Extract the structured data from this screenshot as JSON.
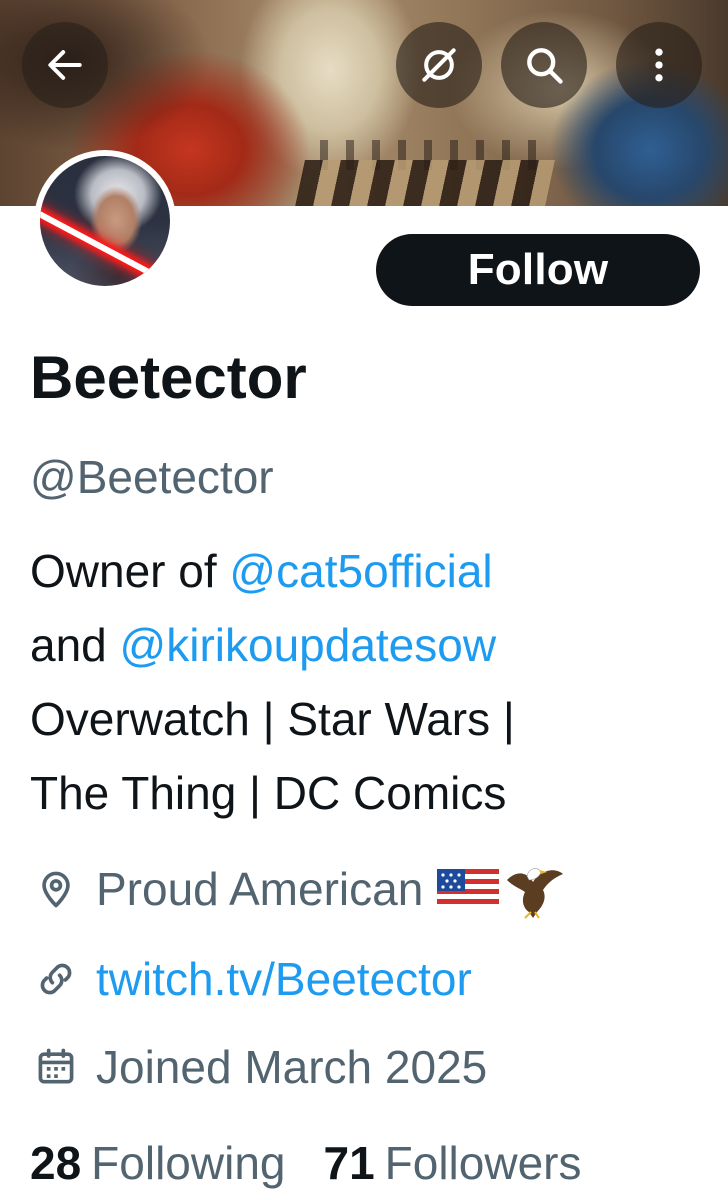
{
  "profile": {
    "display_name": "Beetector",
    "handle": "@Beetector",
    "follow_label": "Follow",
    "bio": {
      "line1_prefix": "Owner of ",
      "line1_mention": "@cat5official",
      "line2_prefix": "and ",
      "line2_mention": "@kirikoupdatesow",
      "line3": "Overwatch | Star Wars |",
      "line4": "The Thing | DC Comics"
    },
    "location": "Proud American",
    "location_icons": [
      "us-flag-icon",
      "eagle-icon"
    ],
    "website": "twitch.tv/Beetector",
    "joined": "Joined March 2025",
    "following_count": "28",
    "following_label": "Following",
    "followers_count": "71",
    "followers_label": "Followers"
  },
  "header_icons": [
    "back-arrow-icon",
    "notifications-off-icon",
    "search-icon",
    "more-vertical-icon"
  ],
  "colors": {
    "accent": "#1d9bf0",
    "text_primary": "#0f1419",
    "text_secondary": "#536471",
    "button_bg": "#0f1419"
  }
}
